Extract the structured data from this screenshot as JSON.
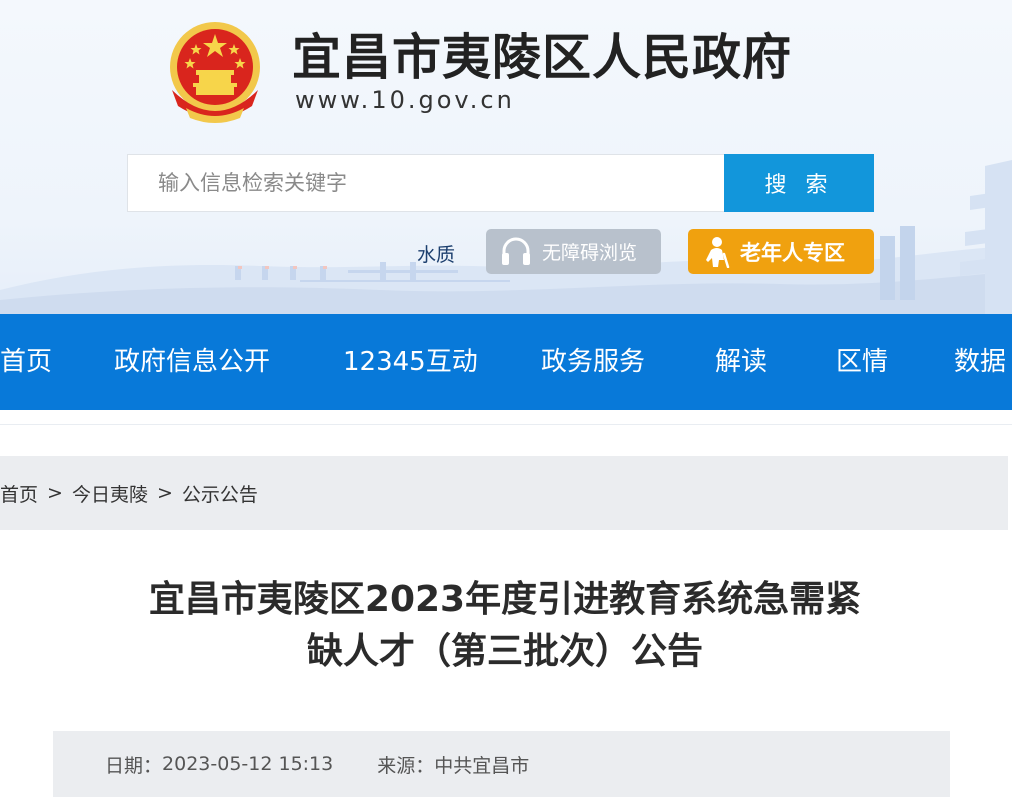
{
  "header": {
    "site_title": "宜昌市夷陵区人民政府",
    "site_url": "www.10.gov.cn",
    "search": {
      "placeholder": "输入信息检索关键字",
      "button_label": "搜 索"
    },
    "water_link": "水质",
    "accessibility_button": "无障碍浏览",
    "elderly_button": "老年人专区",
    "icons": {
      "emblem": "national-emblem-icon",
      "accessibility": "headphones-icon",
      "elderly": "elderly-person-icon"
    },
    "colors": {
      "search_button": "#1296db",
      "elderly_button": "#f0a10f",
      "accessibility_button": "#b8c1cc"
    }
  },
  "nav": {
    "items": [
      "首页",
      "政府信息公开",
      "12345互动",
      "政务服务",
      "解读",
      "区情",
      "数据"
    ],
    "color": "#0879d9"
  },
  "breadcrumb": {
    "items": [
      "首页",
      "今日夷陵",
      "公示公告"
    ],
    "separator": ">"
  },
  "article": {
    "title_line1": "宜昌市夷陵区2023年度引进教育系统急需紧",
    "title_line2": "缺人才（第三批次）公告",
    "date_label": "日期：",
    "date": "2023-05-12 15:13",
    "source_label": "来源：",
    "source": "中共宜昌市"
  }
}
